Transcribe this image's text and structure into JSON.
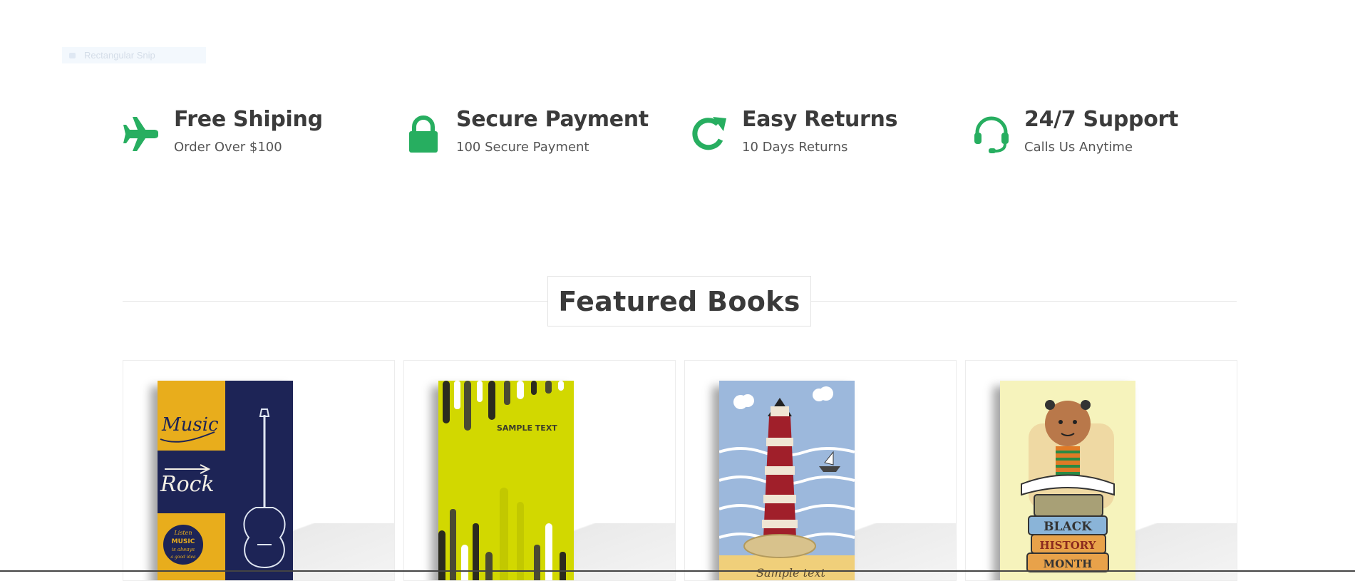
{
  "overlay": {
    "label": "Rectangular Snip"
  },
  "features": [
    {
      "icon": "airplane-icon",
      "title": "Free Shiping",
      "subtitle": "Order Over $100"
    },
    {
      "icon": "lock-icon",
      "title": "Secure Payment",
      "subtitle": "100 Secure Payment"
    },
    {
      "icon": "refresh-icon",
      "title": "Easy Returns",
      "subtitle": "10 Days Returns"
    },
    {
      "icon": "headset-icon",
      "title": "24/7 Support",
      "subtitle": "Calls Us Anytime"
    }
  ],
  "accent_color": "#27ae60",
  "section": {
    "title": "Featured Books"
  },
  "books": [
    {
      "cover_icon": "music-rock-cover",
      "cover_texts": {
        "word1": "Music",
        "word2": "Rock",
        "badge_line1": "Listen",
        "badge_line2": "MUSIC",
        "badge_line3": "is always",
        "badge_line4": "a good idea"
      }
    },
    {
      "cover_icon": "lime-sample-cover",
      "cover_texts": {
        "word1": "SAMPLE TEXT"
      }
    },
    {
      "cover_icon": "lighthouse-cover",
      "cover_texts": {
        "word1": "Sample text"
      }
    },
    {
      "cover_icon": "black-history-cover",
      "cover_texts": {
        "word1": "BLACK",
        "word2": "HISTORY",
        "word3": "MONTH"
      }
    }
  ]
}
